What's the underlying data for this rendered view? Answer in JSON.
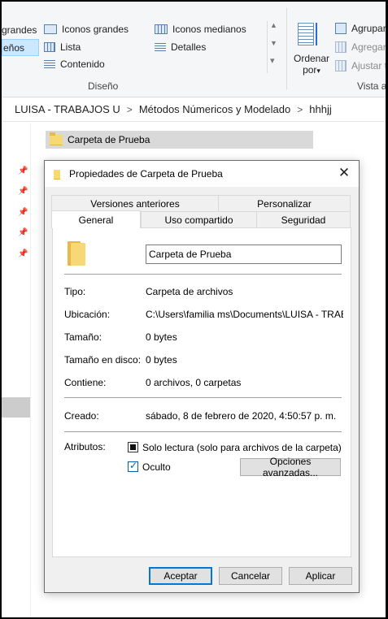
{
  "ribbon": {
    "layout_items": [
      {
        "label": "grandes",
        "icon": "large-icons-icon"
      },
      {
        "label": "Iconos grandes",
        "icon": "large-icons-icon"
      },
      {
        "label": "Iconos medianos",
        "icon": "medium-icons-icon"
      },
      {
        "label": "eños",
        "icon": "small-icons-icon",
        "selected": true
      },
      {
        "label": "Lista",
        "icon": "list-view-icon"
      },
      {
        "label": "Detalles",
        "icon": "details-view-icon"
      },
      {
        "label": "Contenido",
        "icon": "content-view-icon"
      }
    ],
    "group_layout_label": "Diseño",
    "sort_label_line1": "Ordenar",
    "sort_label_line2": "por",
    "sort_arrow": "▾",
    "group_by_label": "Agrupar",
    "add_columns_label": "Agregar",
    "fit_columns_label": "Ajustar t",
    "group_view_label": "Vista a",
    "scroll_up": "▲",
    "scroll_down": "▼",
    "scroll_more": "▾"
  },
  "address": {
    "crumbs": [
      "LUISA - TRABAJOS U",
      "Métodos Númericos y Modelado",
      "hhhjj"
    ],
    "separator": ">"
  },
  "navpane": {
    "pin_glyph": "📌"
  },
  "listing": {
    "selected_folder": "Carpeta de Prueba"
  },
  "dialog": {
    "title": "Propiedades de Carpeta de Prueba",
    "close_glyph": "✕",
    "tabs_back": [
      "Versiones anteriores",
      "Personalizar"
    ],
    "tabs_front": [
      "General",
      "Uso compartido",
      "Seguridad"
    ],
    "active_tab": "General",
    "folder_name": "Carpeta de Prueba",
    "properties": [
      {
        "label": "Tipo:",
        "value": "Carpeta de archivos"
      },
      {
        "label": "Ubicación:",
        "value": "C:\\Users\\familia ms\\Documents\\LUISA - TRAB"
      },
      {
        "label": "Tamaño:",
        "value": "0 bytes"
      },
      {
        "label": "Tamaño en disco:",
        "value": "0 bytes"
      },
      {
        "label": "Contiene:",
        "value": "0 archivos, 0 carpetas"
      }
    ],
    "created_label": "Creado:",
    "created_value": "sábado, 8 de febrero de 2020, 4:50:57 p. m.",
    "attributes_label": "Atributos:",
    "readonly_label": "Solo lectura (solo para archivos de la carpeta)",
    "readonly_state": "indeterminate",
    "hidden_label": "Oculto",
    "hidden_state": "checked",
    "advanced_button": "Opciones avanzadas...",
    "buttons": {
      "ok": "Aceptar",
      "cancel": "Cancelar",
      "apply": "Aplicar"
    }
  }
}
